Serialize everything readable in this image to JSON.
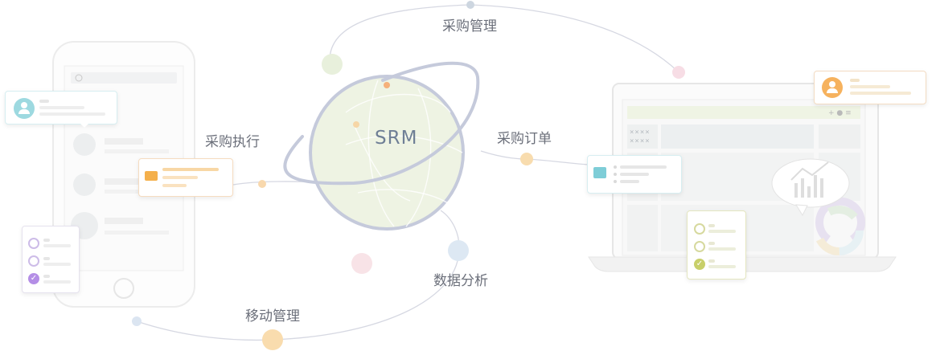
{
  "center": {
    "label": "SRM"
  },
  "nodes": {
    "procurement_mgmt": "采购管理",
    "procurement_exec": "采购执行",
    "procurement_order": "采购订单",
    "data_analysis": "数据分析",
    "mobile_mgmt": "移动管理"
  },
  "laptop": {
    "placeholder_text": "××××\n××××"
  },
  "colors": {
    "globe_fill": "#eef3e3",
    "ring": "#c5cadb",
    "orange": "#f7c58e",
    "cyan": "#9dd9e0",
    "purple": "#b48ee6",
    "olive": "#cfd48a",
    "pink": "#f6d5dd",
    "blue": "#d5e4f2"
  }
}
